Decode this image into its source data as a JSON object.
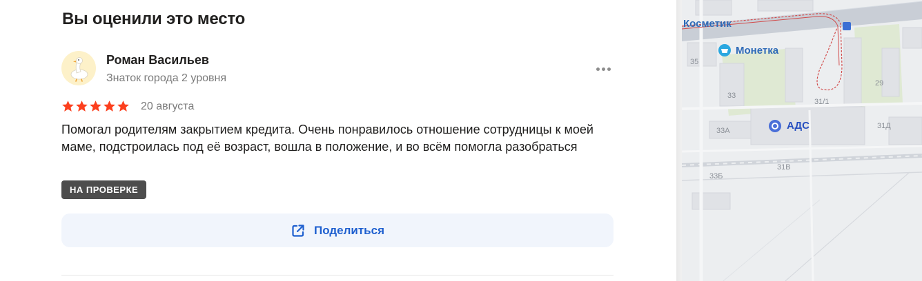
{
  "section": {
    "title": "Вы оценили это место"
  },
  "review": {
    "author": {
      "name": "Роман Васильев",
      "level": "Знаток города 2 уровня"
    },
    "rating": 5,
    "date": "20 августа",
    "text": "Помогал родителям закрытием кредита. Очень понравилось отношение сотрудницы к моей маме, подстроилась под её возраст, вошла в положение, и во всём помогла разобраться",
    "status": "НА ПРОВЕРКЕ"
  },
  "actions": {
    "share_label": "Поделиться"
  },
  "icons": {
    "more": "more-dots-icon",
    "share": "share-external-icon",
    "star": "star-icon",
    "avatar": "goose-avatar-icon"
  },
  "colors": {
    "star": "#fc3f1d",
    "badge_bg": "#4d4d4d",
    "link": "#1e5fcf",
    "button_bg": "#f1f5fc",
    "poi": "#1d65d6"
  },
  "map": {
    "poi": [
      {
        "name": "Косметик"
      },
      {
        "name": "Монетка"
      },
      {
        "name": "АДС"
      }
    ],
    "house_numbers": [
      "35",
      "33",
      "31/1",
      "29",
      "33А",
      "31Д",
      "31В",
      "33Б"
    ]
  }
}
